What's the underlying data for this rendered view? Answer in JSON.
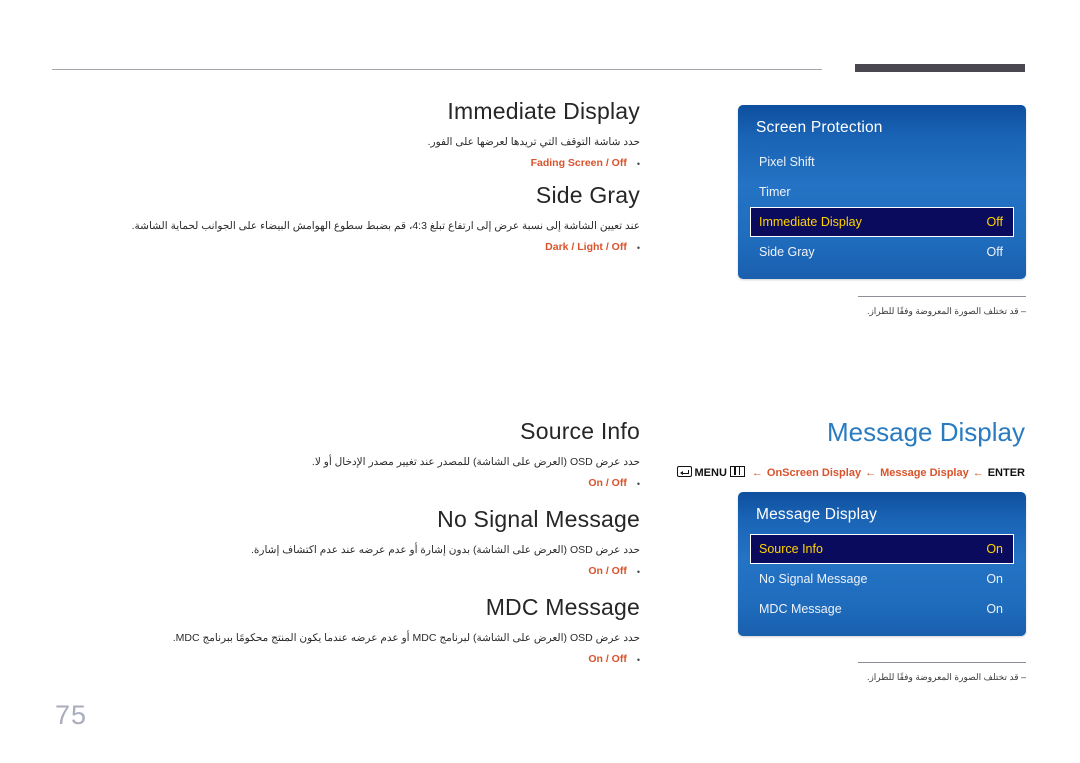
{
  "page": {
    "number": "75"
  },
  "sections": [
    {
      "id": "immediate-display",
      "title": "Immediate Display",
      "description": "حدد شاشة التوقف التي تريدها لعرضها على الفور.",
      "options": [
        "Fading Screen",
        "Off"
      ],
      "options_text": "Fading Screen / Off"
    },
    {
      "id": "side-gray",
      "title": "Side Gray",
      "description": "عند تعيين الشاشة إلى نسبة عرض إلى ارتفاع تبلغ 4:3، قم بضبط سطوع الهوامش البيضاء على الجوانب لحماية الشاشة.",
      "options": [
        "Dark",
        "Light",
        "Off"
      ],
      "options_text": "Dark / Light / Off"
    },
    {
      "id": "source-info",
      "title": "Source Info",
      "description": "حدد عرض OSD (العرض على الشاشة) للمصدر عند تغيير مصدر الإدخال أو لا.",
      "options": [
        "On",
        "Off"
      ],
      "options_text": "On / Off"
    },
    {
      "id": "no-signal-message",
      "title": "No Signal Message",
      "description": "حدد عرض OSD (العرض على الشاشة) بدون إشارة أو عدم عرضه عند عدم اكتشاف إشارة.",
      "options": [
        "On",
        "Off"
      ],
      "options_text": "On / Off"
    },
    {
      "id": "mdc-message",
      "title": "MDC Message",
      "description": "حدد عرض OSD (العرض على الشاشة) لبرنامج MDC أو عدم عرضه عندما يكون المنتج محكومًا ببرنامج MDC.",
      "options": [
        "On",
        "Off"
      ],
      "options_text": "On / Off"
    }
  ],
  "right": {
    "heading": "Message Display",
    "heading_color": "#2a7bc0",
    "breadcrumb": {
      "menu_label": "MENU",
      "level1": "OnScreen Display",
      "level2": "Message Display",
      "enter_label": "ENTER",
      "arrow": "←",
      "accent_color": "#d9532c"
    }
  },
  "osd_panels": [
    {
      "id": "screen-protection",
      "title": "Screen Protection",
      "rows": [
        {
          "label": "Pixel Shift",
          "value": "",
          "selected": false
        },
        {
          "label": "Timer",
          "value": "",
          "selected": false
        },
        {
          "label": "Immediate Display",
          "value": "Off",
          "selected": true
        },
        {
          "label": "Side Gray",
          "value": "Off",
          "selected": false
        }
      ]
    },
    {
      "id": "message-display",
      "title": "Message Display",
      "rows": [
        {
          "label": "Source Info",
          "value": "On",
          "selected": true
        },
        {
          "label": "No Signal Message",
          "value": "On",
          "selected": false
        },
        {
          "label": "MDC Message",
          "value": "On",
          "selected": false
        }
      ]
    }
  ],
  "footnotes": {
    "model_note": "‒ قد تختلف الصورة المعروضة وفقًا للطراز."
  }
}
